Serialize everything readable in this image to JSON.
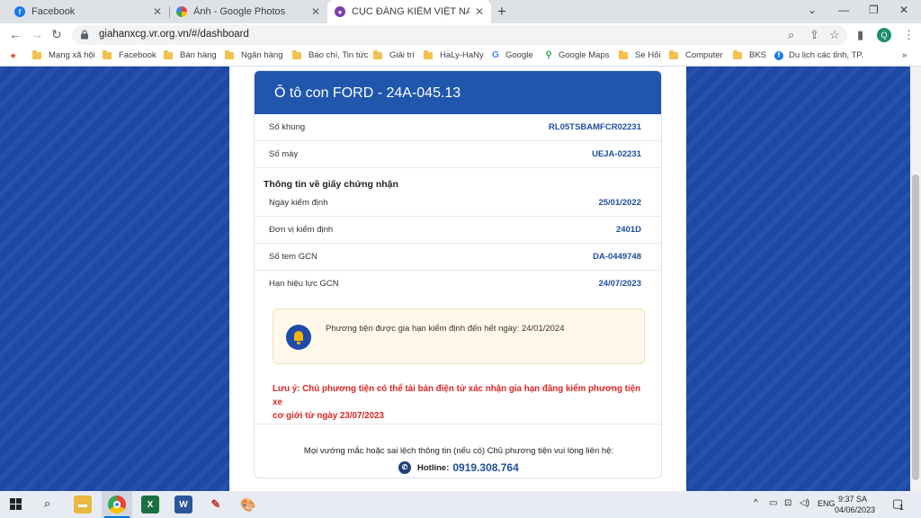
{
  "browser": {
    "tabs": [
      {
        "title": "Facebook",
        "favicon_color": "#1877f2",
        "active": false
      },
      {
        "title": "Ảnh - Google Photos",
        "favicon_color": "#ea4335",
        "active": false
      },
      {
        "title": "CỤC ĐĂNG KIỂM VIỆT NAM",
        "favicon_color": "#7b3fb0",
        "active": true
      }
    ],
    "url": "giahanxcg.vr.org.vn/#/dashboard",
    "profile_initial": "Q",
    "bookmarks": [
      {
        "label": "Mạng xã hội",
        "icon": "folder-icon"
      },
      {
        "label": "Facebook",
        "icon": "folder-icon"
      },
      {
        "label": "Bán hàng",
        "icon": "folder-icon"
      },
      {
        "label": "Ngân hàng",
        "icon": "folder-icon"
      },
      {
        "label": "Báo chí, Tin tức",
        "icon": "folder-icon"
      },
      {
        "label": "Giải trí",
        "icon": "folder-icon"
      },
      {
        "label": "HaLy-HaNy",
        "icon": "folder-icon"
      },
      {
        "label": "Google",
        "icon": "google-icon"
      },
      {
        "label": "Google Maps",
        "icon": "maps-icon"
      },
      {
        "label": "Se Hỏi",
        "icon": "folder-icon"
      },
      {
        "label": "Computer",
        "icon": "folder-icon"
      },
      {
        "label": "BKS",
        "icon": "folder-icon"
      },
      {
        "label": "Du lịch các tỉnh, TP.",
        "icon": "facebook-icon"
      }
    ]
  },
  "card": {
    "title": "Ô tô con FORD - 24A-045.13",
    "vehicle_rows": [
      {
        "label": "Số khung",
        "value": "RL05TSBAMFCR02231"
      },
      {
        "label": "Số máy",
        "value": "UEJA-02231"
      }
    ],
    "cert_section_title": "Thông tin về giấy chứng nhận",
    "cert_rows": [
      {
        "label": "Ngày kiểm định",
        "value": "25/01/2022"
      },
      {
        "label": "Đơn vị kiểm định",
        "value": "2401D"
      },
      {
        "label": "Số tem GCN",
        "value": "DA-0449748"
      },
      {
        "label": "Hạn hiệu lực GCN",
        "value": "24/07/2023"
      }
    ],
    "notice": "Phương tiện được gia hạn kiểm định đến hết ngày: 24/01/2024",
    "warning_line1": "Lưu ý: Chủ phương tiện có thể tải bản điện tử xác nhận gia hạn đăng kiểm phương tiện xe",
    "warning_line2": "cơ giới từ ngày 23/07/2023",
    "contact_text": "Mọi vướng mắc hoặc sai lệch thông tin (nếu có) Chủ phương tiện vui lòng liên hệ:",
    "hotline_label": "Hotline:",
    "hotline_number": "0919.308.764"
  },
  "taskbar": {
    "language": "ENG",
    "time": "9:37 SA",
    "date": "04/06/2023",
    "notification_count": "1"
  },
  "colors": {
    "header_blue": "#2057ad",
    "warning_red": "#e02424",
    "value_blue": "#1f4d9c"
  }
}
